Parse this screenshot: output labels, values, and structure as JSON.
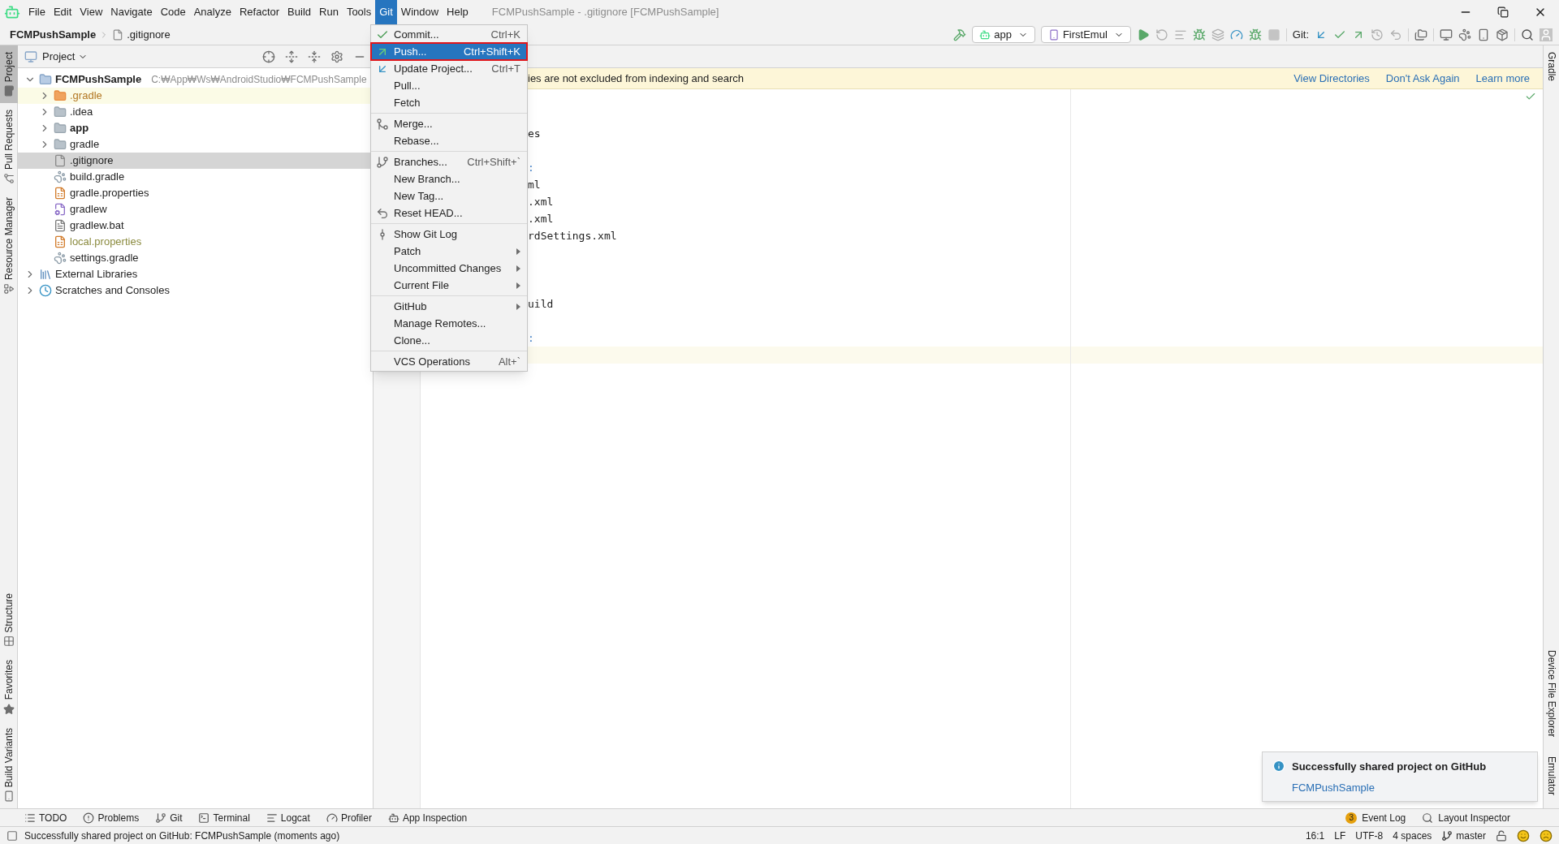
{
  "menu_bar": [
    {
      "label": "File",
      "selected": false
    },
    {
      "label": "Edit",
      "selected": false
    },
    {
      "label": "View",
      "selected": false
    },
    {
      "label": "Navigate",
      "selected": false
    },
    {
      "label": "Code",
      "selected": false
    },
    {
      "label": "Analyze",
      "selected": false
    },
    {
      "label": "Refactor",
      "selected": false
    },
    {
      "label": "Build",
      "selected": false
    },
    {
      "label": "Run",
      "selected": false
    },
    {
      "label": "Tools",
      "selected": false
    },
    {
      "label": "Git",
      "selected": true
    },
    {
      "label": "Window",
      "selected": false
    },
    {
      "label": "Help",
      "selected": false
    }
  ],
  "window_title": "FCMPushSample - .gitignore [FCMPushSample]",
  "breadcrumb": [
    "FCMPushSample",
    ".gitignore"
  ],
  "toolbar": {
    "run_config": "app",
    "device": "FirstEmul",
    "git_label": "Git:"
  },
  "left_stripe": {
    "top": [
      {
        "label": "Project",
        "selected": true
      },
      {
        "label": "Pull Requests",
        "selected": false
      },
      {
        "label": "Resource Manager",
        "selected": false
      }
    ],
    "bottom": [
      {
        "label": "Structure",
        "selected": false
      },
      {
        "label": "Favorites",
        "selected": false
      },
      {
        "label": "Build Variants",
        "selected": false
      }
    ]
  },
  "right_stripe": {
    "top": [
      "Gradle"
    ],
    "bottom": [
      "Device File Explorer",
      "Emulator"
    ]
  },
  "project_panel": {
    "title": "Project",
    "tree": [
      {
        "label": "FCMPushSample",
        "path": "C:₩App₩Ws₩AndroidStudio₩FCMPushSample",
        "kind": "root",
        "expanded": true,
        "selected": false,
        "children": [
          {
            "label": ".gradle",
            "kind": "folder",
            "expanded": false,
            "excluded": true,
            "selected": false
          },
          {
            "label": ".idea",
            "kind": "folder",
            "expanded": false,
            "excluded": false,
            "selected": false
          },
          {
            "label": "app",
            "kind": "module",
            "expanded": false,
            "excluded": false,
            "selected": false
          },
          {
            "label": "gradle",
            "kind": "folder",
            "expanded": false,
            "excluded": false,
            "selected": false
          },
          {
            "label": ".gitignore",
            "kind": "file",
            "ignored": false,
            "selected": true
          },
          {
            "label": "build.gradle",
            "kind": "gradle",
            "ignored": false,
            "selected": false
          },
          {
            "label": "gradle.properties",
            "kind": "properties",
            "ignored": false,
            "selected": false
          },
          {
            "label": "gradlew",
            "kind": "script",
            "ignored": false,
            "selected": false
          },
          {
            "label": "gradlew.bat",
            "kind": "text",
            "ignored": false,
            "selected": false
          },
          {
            "label": "local.properties",
            "kind": "properties",
            "ignored": true,
            "selected": false
          },
          {
            "label": "settings.gradle",
            "kind": "gradle",
            "ignored": false,
            "selected": false
          }
        ]
      },
      {
        "label": "External Libraries",
        "kind": "library",
        "expanded": false,
        "selected": false
      },
      {
        "label": "Scratches and Consoles",
        "kind": "scratch",
        "expanded": false,
        "selected": false
      }
    ]
  },
  "banner": {
    "text": "ies are not excluded from indexing and search",
    "links": [
      "View Directories",
      "Don't Ask Again",
      "Learn more"
    ]
  },
  "editor": {
    "lines": [
      {
        "current": false
      },
      {
        "current": false
      },
      {
        "text": "es",
        "current": false
      },
      {
        "current": false
      },
      {
        "text": ":",
        "current": false
      },
      {
        "text": "ml",
        "current": false
      },
      {
        "text": ".xml",
        "current": false
      },
      {
        "text": ".xml",
        "current": false
      },
      {
        "text": "rdSettings.xml",
        "current": false
      },
      {
        "current": false
      },
      {
        "current": false
      },
      {
        "current": false
      },
      {
        "text": "uild",
        "current": false
      },
      {
        "current": false
      },
      {
        "text": ":",
        "current": false
      },
      {
        "current": true
      }
    ]
  },
  "git_menu": [
    [
      {
        "label": "Commit...",
        "shortcut": "Ctrl+K",
        "selected": false
      },
      {
        "label": "Push...",
        "shortcut": "Ctrl+Shift+K",
        "selected": true
      },
      {
        "label": "Update Project...",
        "shortcut": "Ctrl+T",
        "selected": false
      },
      {
        "label": "Pull...",
        "selected": false
      },
      {
        "label": "Fetch",
        "selected": false
      }
    ],
    [
      {
        "label": "Merge...",
        "selected": false
      },
      {
        "label": "Rebase...",
        "selected": false
      }
    ],
    [
      {
        "label": "Branches...",
        "shortcut": "Ctrl+Shift+`",
        "selected": false
      },
      {
        "label": "New Branch...",
        "selected": false
      },
      {
        "label": "New Tag...",
        "selected": false
      },
      {
        "label": "Reset HEAD...",
        "selected": false
      }
    ],
    [
      {
        "label": "Show Git Log",
        "selected": false
      },
      {
        "label": "Patch",
        "submenu": true,
        "selected": false
      },
      {
        "label": "Uncommitted Changes",
        "submenu": true,
        "selected": false
      },
      {
        "label": "Current File",
        "submenu": true,
        "selected": false
      }
    ],
    [
      {
        "label": "GitHub",
        "submenu": true,
        "selected": false
      },
      {
        "label": "Manage Remotes...",
        "selected": false
      },
      {
        "label": "Clone...",
        "selected": false
      }
    ],
    [
      {
        "label": "VCS Operations",
        "shortcut": "Alt+`",
        "selected": false
      }
    ]
  ],
  "notification": {
    "title": "Successfully shared project on GitHub",
    "link": "FCMPushSample"
  },
  "bottom_tools": {
    "left": [
      "TODO",
      "Problems",
      "Git",
      "Terminal",
      "Logcat",
      "Profiler",
      "App Inspection"
    ],
    "right": [
      {
        "label": "Event Log",
        "badge": "3"
      },
      {
        "label": "Layout Inspector"
      }
    ]
  },
  "status_bar": {
    "message": "Successfully shared project on GitHub: FCMPushSample (moments ago)",
    "position": "16:1",
    "line_sep": "LF",
    "encoding": "UTF-8",
    "indent": "4 spaces",
    "branch": "master"
  }
}
